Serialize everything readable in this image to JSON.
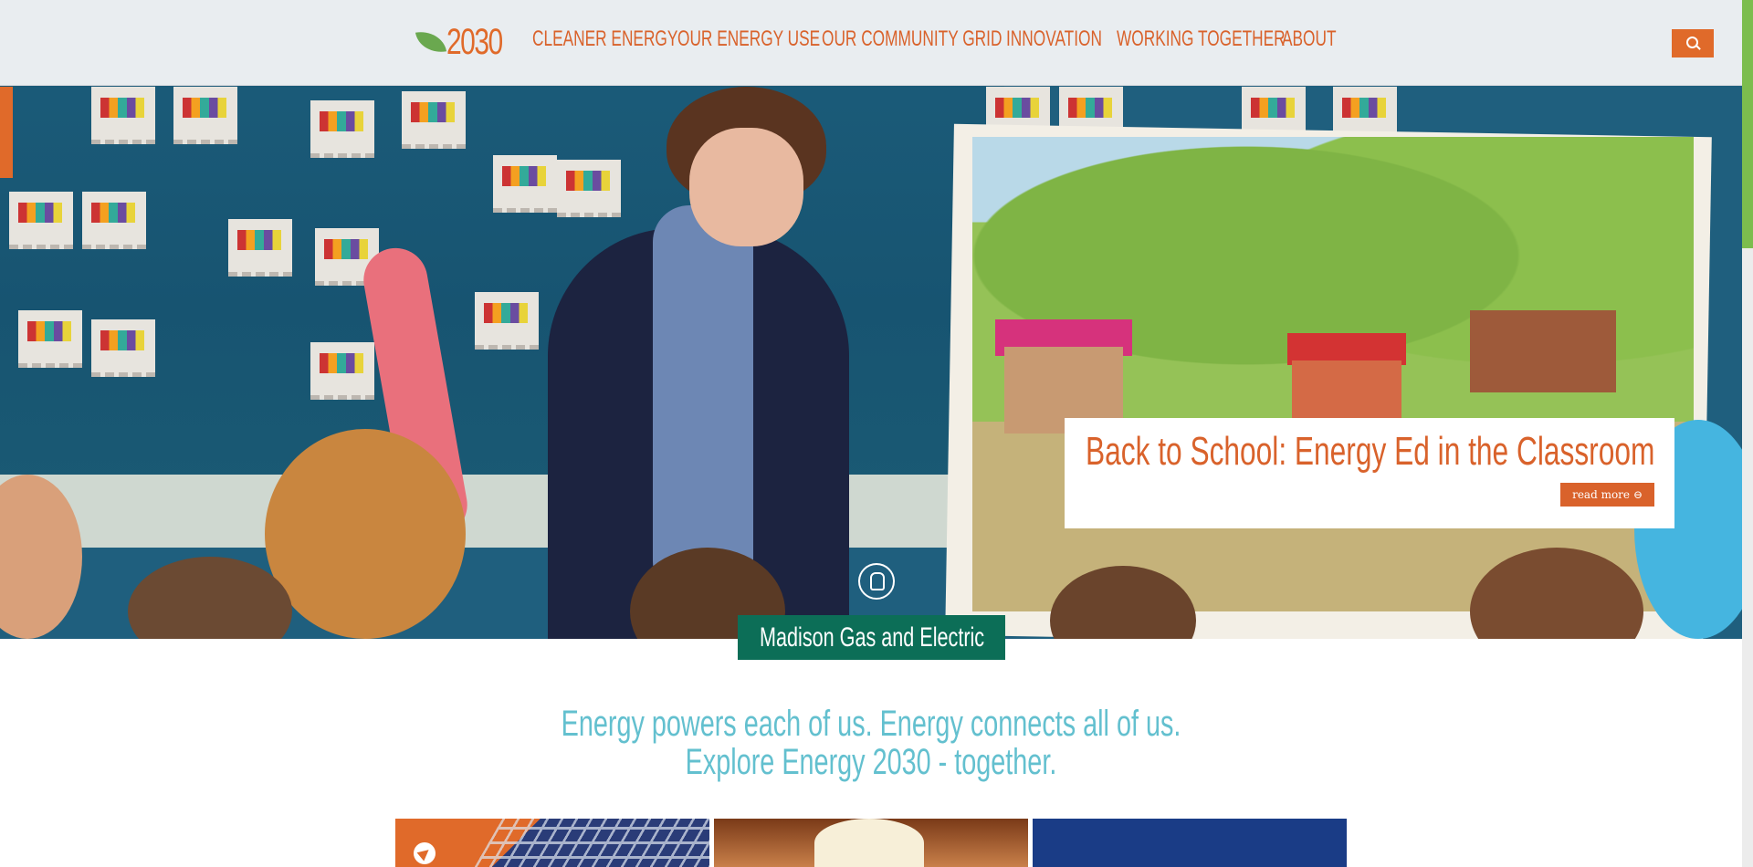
{
  "site": {
    "logo_text": "2030"
  },
  "nav": {
    "items": [
      {
        "label": "CLEANER ENERGY"
      },
      {
        "label": "OUR ENERGY USE"
      },
      {
        "label": "OUR COMMUNITY GRID"
      },
      {
        "label": "INNOVATION"
      },
      {
        "label": "WORKING TOGETHER"
      },
      {
        "label": "ABOUT"
      }
    ]
  },
  "hero": {
    "caption_title": "Back to School: Energy Ed in the Classroom",
    "read_more_label": "read more ⊖"
  },
  "brand": {
    "name": "Madison Gas and Electric"
  },
  "tagline": {
    "line1": "Energy powers each of us. Energy connects all of us.",
    "line2": "Explore Energy 2030 - together."
  },
  "colors": {
    "accent_orange": "#d9622b",
    "brand_green": "#0c6e57",
    "tagline_teal": "#63c0cf",
    "leaf_green": "#6aa84f"
  },
  "icons": {
    "search": "search-icon",
    "pointer": "hand-pointer-icon",
    "send": "paper-plane-icon",
    "logo": "leaf-icon"
  }
}
